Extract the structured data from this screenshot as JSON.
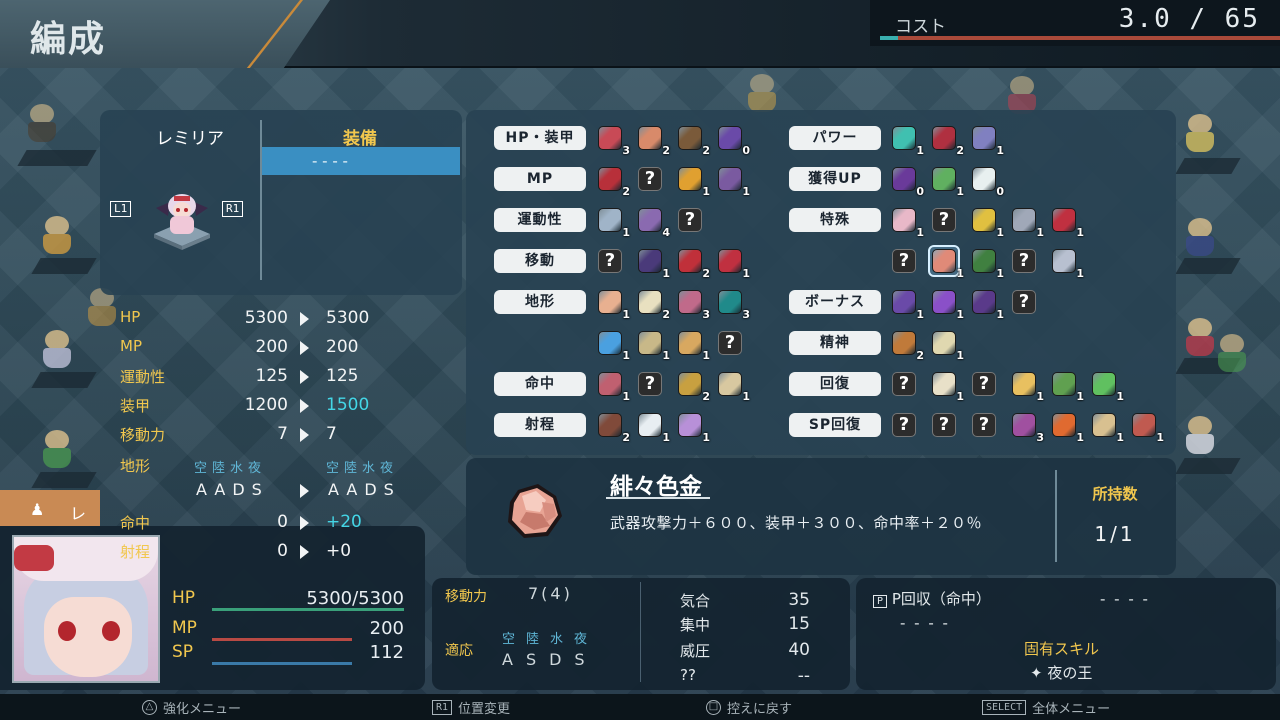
{
  "header": {
    "title": "編成",
    "cost_label": "コスト",
    "cost_value": "3.0 / 65",
    "cost_fraction": 0.046
  },
  "unit": {
    "name": "レミリア",
    "prev_button": "L1",
    "next_button": "R1"
  },
  "equip": {
    "title": "装備",
    "slot": "- - - -"
  },
  "stats": [
    {
      "label": "HP",
      "base": "5300",
      "new": "5300",
      "up": false
    },
    {
      "label": "MP",
      "base": "200",
      "new": "200",
      "up": false
    },
    {
      "label": "運動性",
      "base": "125",
      "new": "125",
      "up": false
    },
    {
      "label": "装甲",
      "base": "1200",
      "new": "1500",
      "up": true
    },
    {
      "label": "移動力",
      "base": "7",
      "new": "7",
      "up": false
    }
  ],
  "terrain": {
    "label": "地形",
    "head_base": "空陸水夜",
    "head_new": "空陸水夜",
    "base": "AADS",
    "new": "AADS"
  },
  "stats2": [
    {
      "label": "命中",
      "base": "0",
      "new": "+20",
      "up": true
    },
    {
      "label": "射程",
      "base": "0",
      "new": "+0",
      "up": false
    }
  ],
  "categories_left": [
    "HP・装甲",
    "MP",
    "運動性",
    "移動",
    "地形",
    "命中",
    "射程"
  ],
  "categories_right": [
    "パワー",
    "獲得UP",
    "特殊",
    "ボーナス",
    "精神",
    "回復",
    "SP回復"
  ],
  "items": {
    "hp": [
      {
        "c": "#c84a56",
        "n": "3"
      },
      {
        "c": "#d88a6a",
        "n": "2"
      },
      {
        "c": "#7a5a3a",
        "n": "2"
      },
      {
        "c": "#6a4aa8",
        "n": "0"
      }
    ],
    "mp": [
      {
        "c": "#b8303a",
        "n": "2"
      },
      {
        "q": true
      },
      {
        "c": "#e0a030",
        "n": "1"
      },
      {
        "c": "#7a5aa0",
        "n": "1"
      }
    ],
    "mob": [
      {
        "c": "#a0b4c8",
        "n": "1"
      },
      {
        "c": "#8a6ab0",
        "n": "4"
      },
      {
        "q": true
      }
    ],
    "move": [
      {
        "q": true
      },
      {
        "c": "#4a3a7a",
        "n": "1"
      },
      {
        "c": "#c0303a",
        "n": "2"
      },
      {
        "c": "#c03040",
        "n": "1"
      }
    ],
    "terrain1": [
      {
        "c": "#e8b090",
        "n": "1"
      },
      {
        "c": "#e8e0c0",
        "n": "2"
      },
      {
        "c": "#c06a8a",
        "n": "3"
      },
      {
        "c": "#208a8a",
        "n": "3"
      }
    ],
    "terrain2": [
      {
        "c": "#4aa0e0",
        "n": "1"
      },
      {
        "c": "#c8b888",
        "n": "1"
      },
      {
        "c": "#d8a860",
        "n": "1"
      },
      {
        "q": true
      }
    ],
    "hit": [
      {
        "c": "#c06070",
        "n": "1"
      },
      {
        "q": true
      },
      {
        "c": "#c8a040",
        "n": "2"
      },
      {
        "c": "#d8c8a0",
        "n": "1"
      }
    ],
    "range": [
      {
        "c": "#804a3a",
        "n": "2"
      },
      {
        "c": "#e8eef2",
        "n": "1"
      },
      {
        "c": "#b890d8",
        "n": "1"
      }
    ],
    "power": [
      {
        "c": "#40c0b0",
        "n": "1"
      },
      {
        "c": "#b03040",
        "n": "2"
      },
      {
        "c": "#8080c0",
        "n": "1"
      }
    ],
    "gain": [
      {
        "c": "#6a3a9a",
        "n": "0"
      },
      {
        "c": "#60b060",
        "n": "1"
      },
      {
        "c": "#e8f0f0",
        "n": "0"
      }
    ],
    "special1": [
      {
        "c": "#e8b8c8",
        "n": "1"
      },
      {
        "q": true
      },
      {
        "c": "#e0c040",
        "n": "1"
      },
      {
        "c": "#a0a8b8",
        "n": "1"
      },
      {
        "c": "#c03040",
        "n": "1"
      }
    ],
    "special2": [
      {
        "q": true
      },
      {
        "c": "#e08a78",
        "n": "1",
        "selected": true
      },
      {
        "c": "#408040",
        "n": "1"
      },
      {
        "q": true
      },
      {
        "c": "#b8c0d0",
        "n": "1"
      }
    ],
    "bonus": [
      {
        "c": "#6a4aa8",
        "n": "1"
      },
      {
        "c": "#8a50c8",
        "n": "1"
      },
      {
        "c": "#5a3a8a",
        "n": "1"
      },
      {
        "q": true
      }
    ],
    "spirit": [
      {
        "c": "#c07a3a",
        "n": "2"
      },
      {
        "c": "#e0d8b0",
        "n": "1"
      }
    ],
    "recover": [
      {
        "q": true
      },
      {
        "c": "#e8e0c8",
        "n": "1"
      },
      {
        "q": true
      },
      {
        "c": "#e8c060",
        "n": "1"
      },
      {
        "c": "#60a050",
        "n": "1"
      },
      {
        "c": "#60c060",
        "n": "1"
      }
    ],
    "sprec": [
      {
        "q": true
      },
      {
        "q": true
      },
      {
        "q": true
      },
      {
        "c": "#a050a0",
        "n": "3"
      },
      {
        "c": "#e06a30",
        "n": "1"
      },
      {
        "c": "#d8c090",
        "n": "1"
      },
      {
        "c": "#c05a50",
        "n": "1"
      }
    ]
  },
  "detail": {
    "name": "緋々色金",
    "description": "武器攻撃力＋６００、装甲＋３００、命中率＋２０％",
    "owned_label": "所持数",
    "owned_value": "1/1"
  },
  "bottom": {
    "tab_initial": "レ",
    "hp_label": "HP",
    "hp_value": "5300/5300",
    "mp_label": "MP",
    "mp_value": "200",
    "sp_label": "SP",
    "sp_value": "112",
    "move_label": "移動力",
    "move_value": "7(4)",
    "adapt_label": "適応",
    "adapt_head": "空陸水夜",
    "adapt_value": "ASDS",
    "stats": [
      {
        "label": "気合",
        "value": "35"
      },
      {
        "label": "集中",
        "value": "15"
      },
      {
        "label": "威圧",
        "value": "40"
      },
      {
        "label": "??",
        "value": "--"
      }
    ],
    "skill_line": "P回収（命中）",
    "skill_line_value": "- - - -",
    "skill_line2": "- - - -",
    "unique_skill_label": "固有スキル",
    "unique_skill": "夜の王"
  },
  "footer": {
    "enhance": "強化メニュー",
    "swap_badge": "R1",
    "swap": "位置変更",
    "bench": "控えに戻す",
    "menu_badge": "SELECT",
    "menu": "全体メニュー"
  }
}
